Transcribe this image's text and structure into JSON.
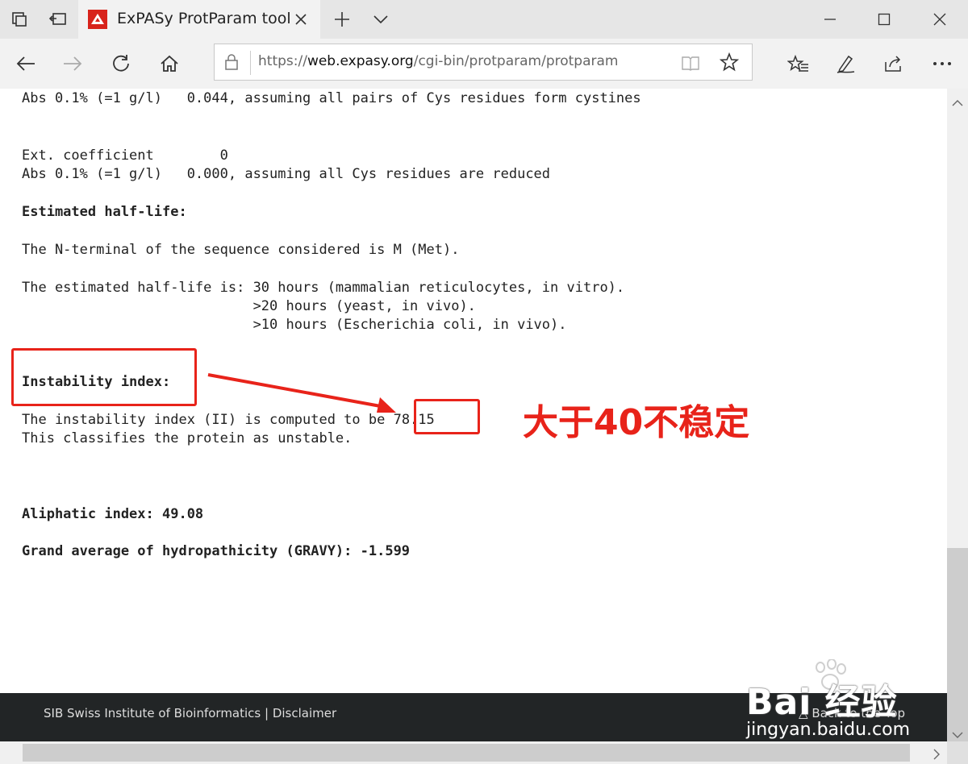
{
  "browser": {
    "tab_title": "ExPASy ProtParam tool",
    "url_prefix": "https://",
    "url_domain": "web.expasy.org",
    "url_path": "/cgi-bin/protparam/protparam"
  },
  "content": {
    "line1": "Abs 0.1% (=1 g/l)   0.044, assuming all pairs of Cys residues form cystines",
    "line2": "Ext. coefficient        0",
    "line3": "Abs 0.1% (=1 g/l)   0.000, assuming all Cys residues are reduced",
    "half_life_heading": "Estimated half-life:",
    "n_terminal": "The N-terminal of the sequence considered is M (Met).",
    "half_life_1": "The estimated half-life is: 30 hours (mammalian reticulocytes, in vitro).",
    "half_life_2": "                            >20 hours (yeast, in vivo).",
    "half_life_3": "                            >10 hours (Escherichia coli, in vivo).",
    "instability_heading": "Instability index:",
    "instability_1_prefix": "The instability index (II) is computed to be ",
    "instability_value": "78.15",
    "instability_2": "This classifies the protein as unstable.",
    "aliphatic": "Aliphatic index: 49.08",
    "gravy": "Grand average of hydropathicity (GRAVY): -1.599"
  },
  "footer": {
    "left": "SIB Swiss Institute of Bioinformatics | Disclaimer",
    "right": "Back to the Top"
  },
  "annotation": {
    "text": "大于40不稳定",
    "color": "#e8231a"
  },
  "watermark": {
    "brand": "Bai 经验",
    "site": "jingyan.baidu.com"
  }
}
